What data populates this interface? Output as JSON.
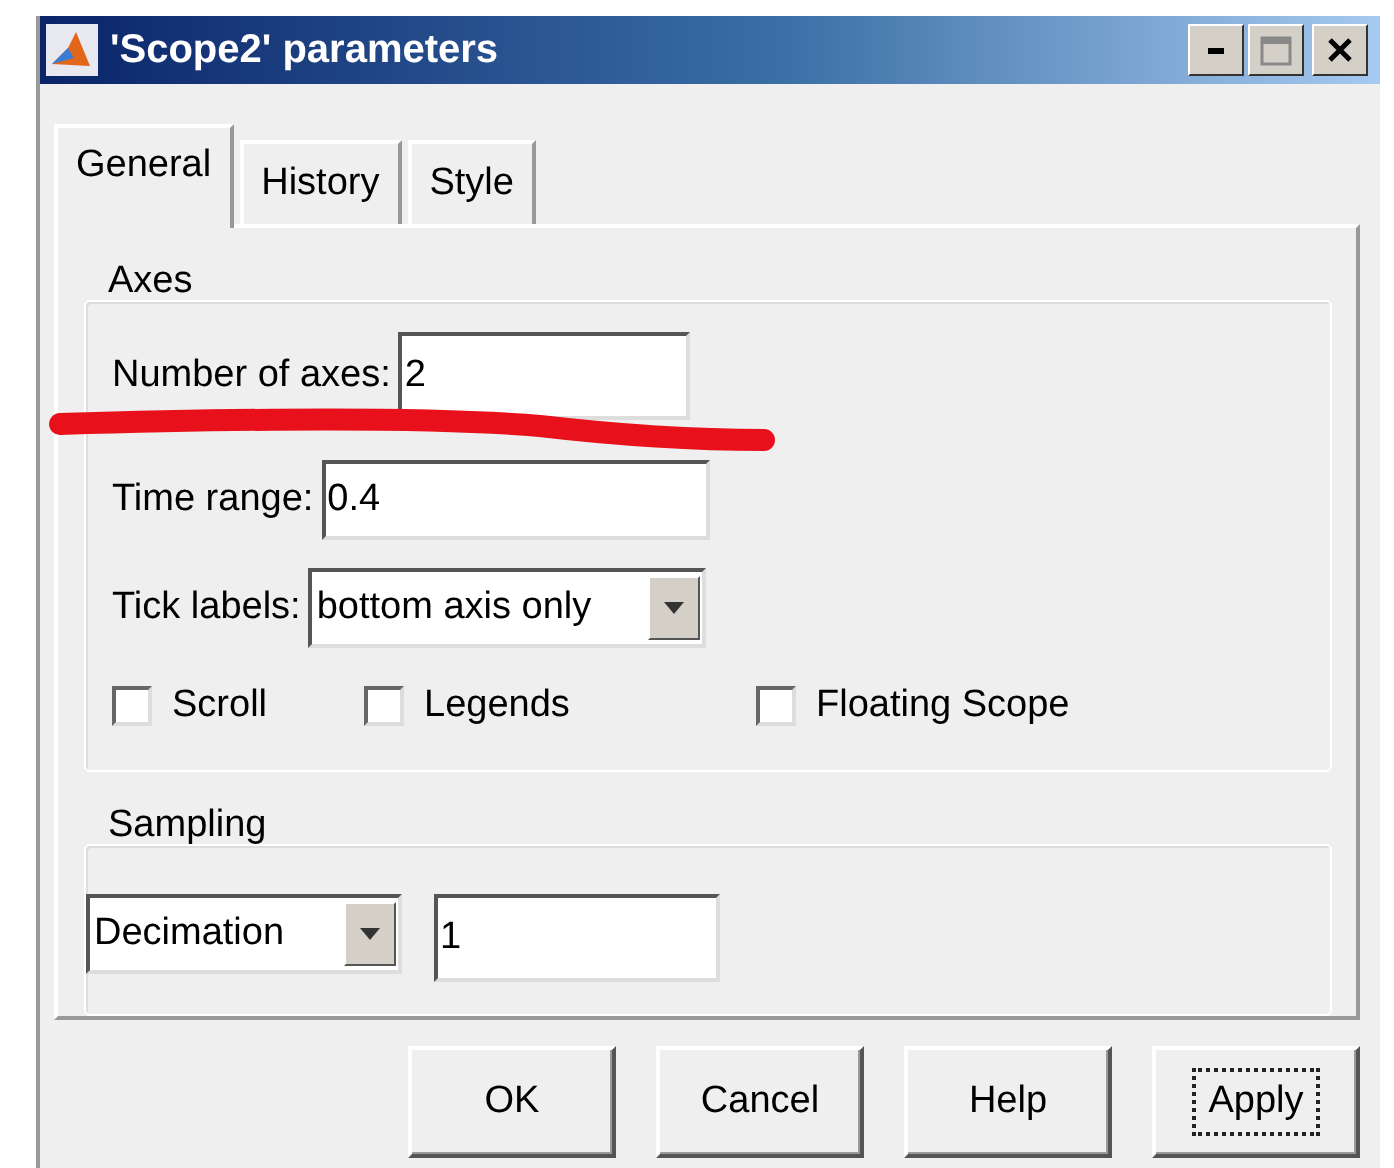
{
  "window": {
    "title": "'Scope2' parameters"
  },
  "tabs": [
    {
      "label": "General",
      "selected": true
    },
    {
      "label": "History",
      "selected": false
    },
    {
      "label": "Style",
      "selected": false
    }
  ],
  "axes": {
    "title": "Axes",
    "fields": [
      {
        "kind": "text",
        "label": "Number of axes:",
        "value": "2"
      },
      {
        "kind": "text",
        "label": "Time range:",
        "value": "0.4"
      },
      {
        "kind": "dropdown",
        "label": "Tick labels:",
        "value": "bottom axis only"
      }
    ],
    "checkboxes": [
      {
        "label": "Scroll",
        "checked": false
      },
      {
        "label": "Legends",
        "checked": false
      },
      {
        "label": "Floating Scope",
        "checked": false
      }
    ]
  },
  "sampling": {
    "title": "Sampling",
    "mode": "Decimation",
    "value": "1"
  },
  "buttons": [
    {
      "label": "OK",
      "focused": false
    },
    {
      "label": "Cancel",
      "focused": false
    },
    {
      "label": "Help",
      "focused": false
    },
    {
      "label": "Apply",
      "focused": true
    }
  ]
}
